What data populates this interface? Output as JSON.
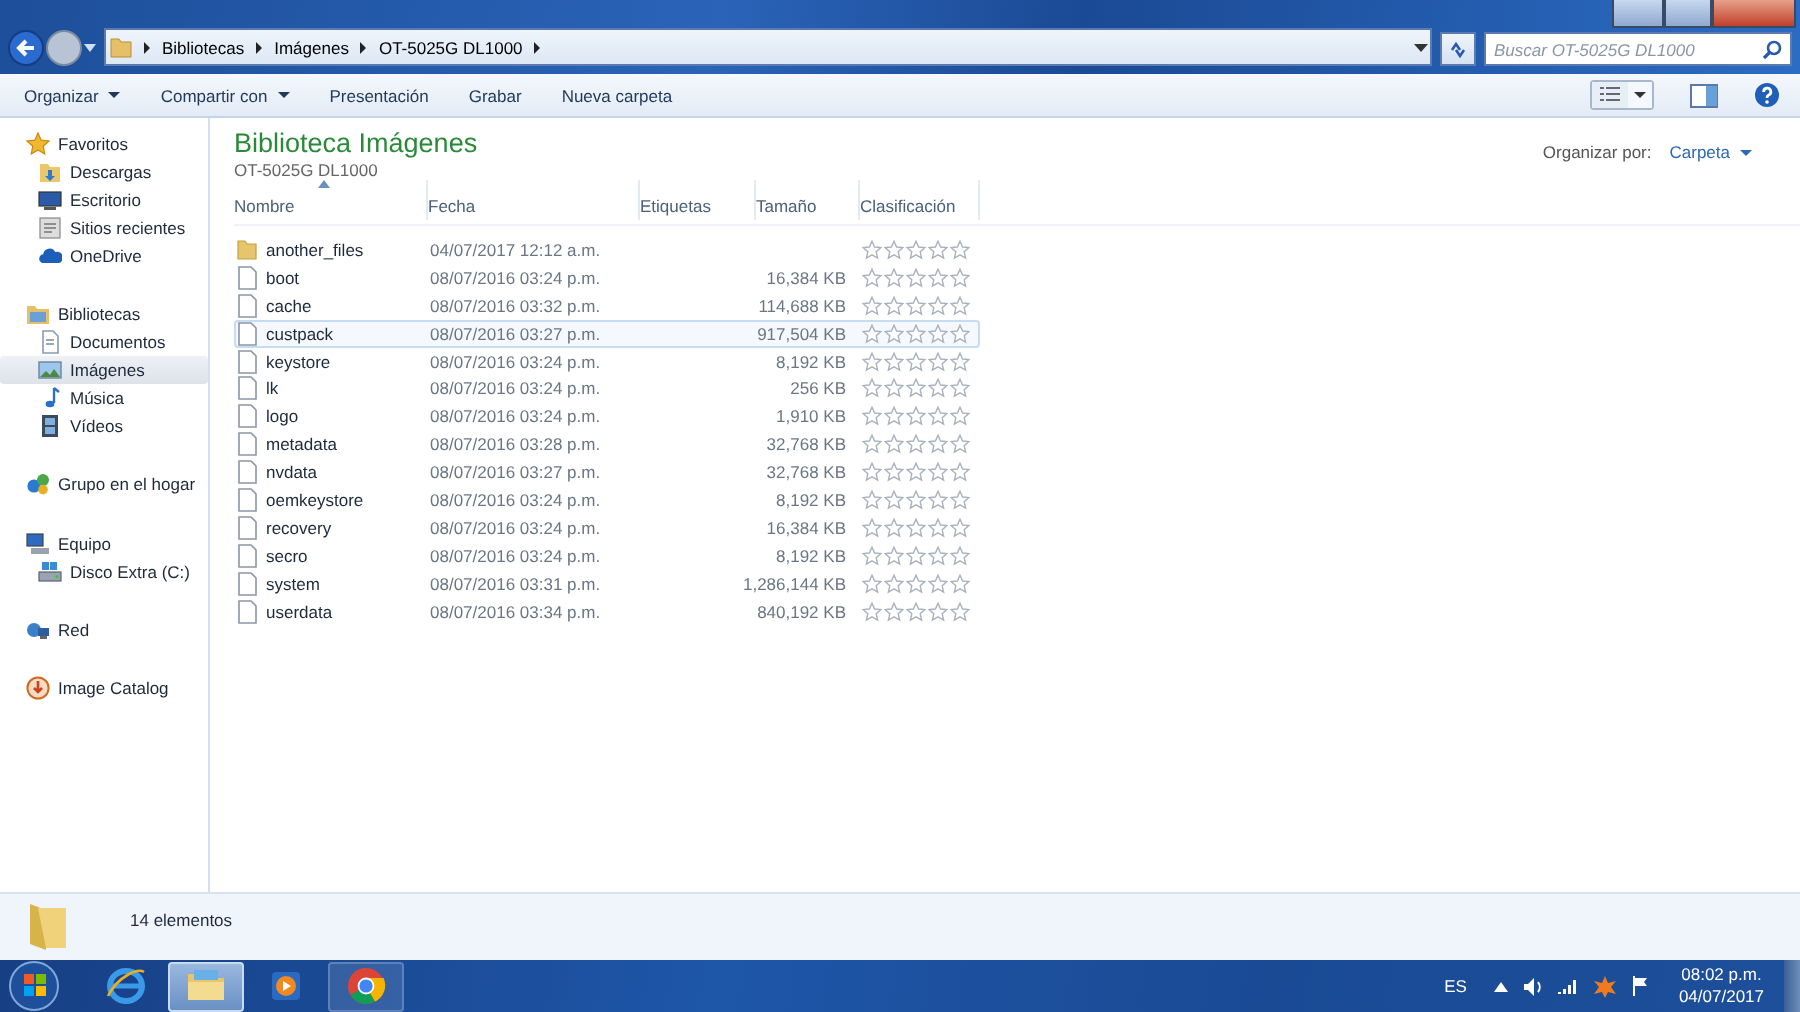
{
  "address": {
    "crumbs": [
      "Bibliotecas",
      "Imágenes",
      "OT-5025G DL1000"
    ]
  },
  "search": {
    "placeholder": "Buscar OT-5025G DL1000"
  },
  "toolbar": {
    "items": [
      {
        "label": "Organizar",
        "dropdown": true
      },
      {
        "label": "Compartir con",
        "dropdown": true
      },
      {
        "label": "Presentación",
        "dropdown": false
      },
      {
        "label": "Grabar",
        "dropdown": false
      },
      {
        "label": "Nueva carpeta",
        "dropdown": false
      }
    ]
  },
  "sidebar": {
    "groups": [
      {
        "label": "Favoritos",
        "kind": "star",
        "children": [
          {
            "label": "Descargas",
            "kind": "download",
            "selected": false
          },
          {
            "label": "Escritorio",
            "kind": "desktop",
            "selected": false
          },
          {
            "label": "Sitios recientes",
            "kind": "recent",
            "selected": false
          },
          {
            "label": "OneDrive",
            "kind": "cloud",
            "selected": false
          }
        ]
      },
      {
        "label": "Bibliotecas",
        "kind": "library",
        "children": [
          {
            "label": "Documentos",
            "kind": "document",
            "selected": false
          },
          {
            "label": "Imágenes",
            "kind": "image",
            "selected": true
          },
          {
            "label": "Música",
            "kind": "music",
            "selected": false
          },
          {
            "label": "Vídeos",
            "kind": "video",
            "selected": false
          }
        ]
      },
      {
        "label": "Grupo en el hogar",
        "kind": "homegroup"
      },
      {
        "label": "Equipo",
        "kind": "computer",
        "children": [
          {
            "label": "Disco Extra (C:)",
            "kind": "drive",
            "selected": false
          }
        ]
      },
      {
        "label": "Red",
        "kind": "network"
      },
      {
        "label": "Image Catalog",
        "kind": "catalog"
      }
    ]
  },
  "library": {
    "title": "Biblioteca Imágenes",
    "subtitle": "OT-5025G DL1000",
    "arrange_label": "Organizar por:",
    "arrange_value": "Carpeta"
  },
  "table": {
    "columns": [
      {
        "label": "Nombre",
        "sorted": true
      },
      {
        "label": "Fecha",
        "sorted": false
      },
      {
        "label": "Etiquetas",
        "sorted": false
      },
      {
        "label": "Tamaño",
        "sorted": false
      },
      {
        "label": "Clasificación",
        "sorted": false
      }
    ],
    "rows": [
      {
        "kind": "folder",
        "name": "another_files",
        "date": "04/07/2017 12:12 a.m.",
        "size": "",
        "stars": 0,
        "hovered": false
      },
      {
        "kind": "file",
        "name": "boot",
        "date": "08/07/2016 03:24 p.m.",
        "size": "16,384 KB",
        "stars": 0,
        "hovered": false
      },
      {
        "kind": "file",
        "name": "cache",
        "date": "08/07/2016 03:32 p.m.",
        "size": "114,688 KB",
        "stars": 0,
        "hovered": false
      },
      {
        "kind": "file",
        "name": "custpack",
        "date": "08/07/2016 03:27 p.m.",
        "size": "917,504 KB",
        "stars": 0,
        "hovered": true
      },
      {
        "kind": "file",
        "name": "keystore",
        "date": "08/07/2016 03:24 p.m.",
        "size": "8,192 KB",
        "stars": 0,
        "hovered": false
      },
      {
        "kind": "file",
        "name": "lk",
        "date": "08/07/2016 03:24 p.m.",
        "size": "256 KB",
        "stars": 0,
        "hovered": false
      },
      {
        "kind": "file",
        "name": "logo",
        "date": "08/07/2016 03:24 p.m.",
        "size": "1,910 KB",
        "stars": 0,
        "hovered": false
      },
      {
        "kind": "file",
        "name": "metadata",
        "date": "08/07/2016 03:28 p.m.",
        "size": "32,768 KB",
        "stars": 0,
        "hovered": false
      },
      {
        "kind": "file",
        "name": "nvdata",
        "date": "08/07/2016 03:27 p.m.",
        "size": "32,768 KB",
        "stars": 0,
        "hovered": false
      },
      {
        "kind": "file",
        "name": "oemkeystore",
        "date": "08/07/2016 03:24 p.m.",
        "size": "8,192 KB",
        "stars": 0,
        "hovered": false
      },
      {
        "kind": "file",
        "name": "recovery",
        "date": "08/07/2016 03:24 p.m.",
        "size": "16,384 KB",
        "stars": 0,
        "hovered": false
      },
      {
        "kind": "file",
        "name": "secro",
        "date": "08/07/2016 03:24 p.m.",
        "size": "8,192 KB",
        "stars": 0,
        "hovered": false
      },
      {
        "kind": "file",
        "name": "system",
        "date": "08/07/2016 03:31 p.m.",
        "size": "1,286,144 KB",
        "stars": 0,
        "hovered": false
      },
      {
        "kind": "file",
        "name": "userdata",
        "date": "08/07/2016 03:34 p.m.",
        "size": "840,192 KB",
        "stars": 0,
        "hovered": false
      }
    ]
  },
  "status": {
    "count": "14 elementos"
  },
  "taskbar": {
    "apps": [
      {
        "kind": "ie",
        "active": false
      },
      {
        "kind": "explorer",
        "active": true
      },
      {
        "kind": "media",
        "active": false
      },
      {
        "kind": "chrome",
        "active": false
      }
    ],
    "language": "ES",
    "time": "08:02 p.m.",
    "date": "04/07/2017"
  }
}
